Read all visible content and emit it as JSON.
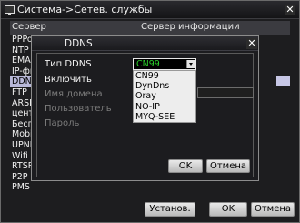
{
  "window": {
    "title": "Система->Сетев. службы"
  },
  "list": {
    "col_service": "Сервер",
    "col_info": "Сервер информации",
    "items": [
      "PPPoE",
      "NTP",
      "EMAIL",
      "IP-фил",
      "DDNS",
      "FTP",
      "ARSP",
      "центр",
      "Беспр",
      "Mobile",
      "UPNP",
      "Wifi",
      "RTSP",
      "P2P",
      "PMS"
    ],
    "selected_index": 4
  },
  "bottom_buttons": {
    "setup": "Установ.",
    "ok": "OK",
    "cancel": "Отмена"
  },
  "ddns_dialog": {
    "title": "DDNS",
    "labels": {
      "type": "Тип DDNS",
      "enable": "Включить",
      "domain": "Имя домена",
      "user": "Пользователь",
      "password": "Пароль"
    },
    "select": {
      "value": "CN99",
      "options": [
        "CN99",
        "DynDns",
        "Oray",
        "NO-IP",
        "MYQ-SEE"
      ]
    },
    "buttons": {
      "ok": "OK",
      "cancel": "Отмена"
    }
  },
  "colors": {
    "selection_bg": "#b8b8d8",
    "selected_option_text": "#2ad02a"
  }
}
